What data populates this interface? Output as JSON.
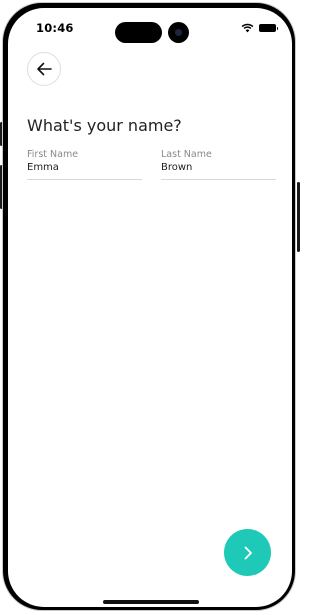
{
  "status_bar": {
    "time": "10:46"
  },
  "header": {
    "back_icon": "arrow-left-icon"
  },
  "main": {
    "title": "What's your name?",
    "first_name": {
      "label": "First Name",
      "value": "Emma"
    },
    "last_name": {
      "label": "Last Name",
      "value": "Brown"
    }
  },
  "footer": {
    "next_icon": "chevron-right-icon"
  },
  "colors": {
    "accent": "#1ec9b7"
  }
}
